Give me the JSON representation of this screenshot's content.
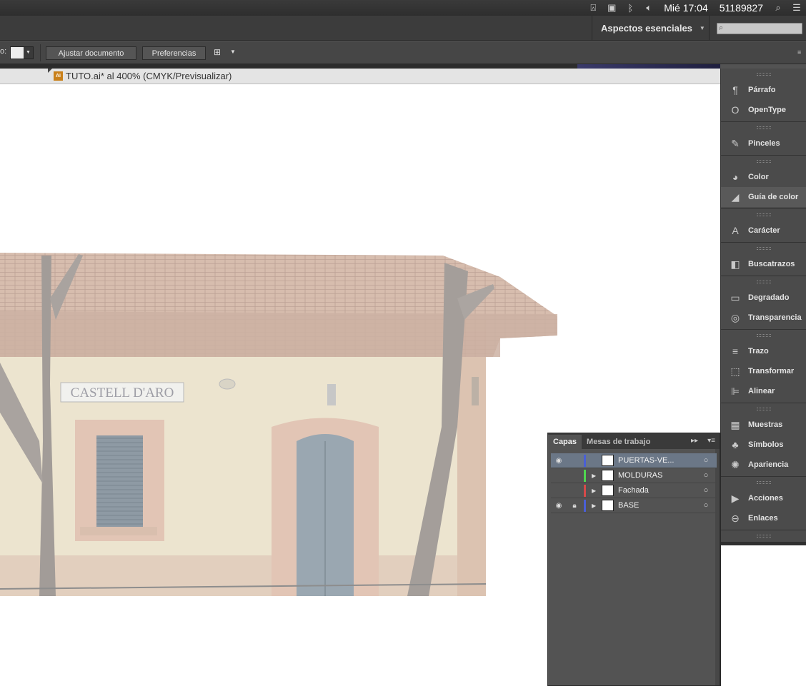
{
  "menubar": {
    "icons": [
      "adobe-icon",
      "display-icon",
      "bluetooth-icon",
      "volume-icon"
    ],
    "clock": "Mié 17:04",
    "user": "51189827"
  },
  "appbar": {
    "workspace_label": "Aspectos esenciales",
    "search_placeholder": ""
  },
  "controlbar": {
    "label_fragment": "o:",
    "fit_document_label": "Ajustar documento",
    "preferences_label": "Preferencias"
  },
  "document": {
    "tab_title": "TUTO.ai* al 400% (CMYK/Previsualizar)",
    "file_badge": "Ai",
    "sign_text": "CASTELL D'ARO"
  },
  "dock": {
    "groups": [
      [
        {
          "label": "Párrafo",
          "icon": "paragraph-icon"
        },
        {
          "label": "OpenType",
          "icon": "opentype-icon"
        }
      ],
      [
        {
          "label": "Pinceles",
          "icon": "brush-icon"
        }
      ],
      [
        {
          "label": "Color",
          "icon": "palette-icon"
        },
        {
          "label": "Guía de color",
          "icon": "color-guide-icon"
        }
      ],
      [
        {
          "label": "Carácter",
          "icon": "character-icon"
        }
      ],
      [
        {
          "label": "Buscatrazos",
          "icon": "pathfinder-icon"
        }
      ],
      [
        {
          "label": "Degradado",
          "icon": "gradient-icon"
        },
        {
          "label": "Transparencia",
          "icon": "transparency-icon"
        }
      ],
      [
        {
          "label": "Trazo",
          "icon": "stroke-icon"
        },
        {
          "label": "Transformar",
          "icon": "transform-icon"
        },
        {
          "label": "Alinear",
          "icon": "align-icon"
        }
      ],
      [
        {
          "label": "Muestras",
          "icon": "swatches-icon"
        },
        {
          "label": "Símbolos",
          "icon": "symbols-icon"
        },
        {
          "label": "Apariencia",
          "icon": "appearance-icon"
        }
      ],
      [
        {
          "label": "Acciones",
          "icon": "actions-icon"
        },
        {
          "label": "Enlaces",
          "icon": "links-icon"
        }
      ],
      [
        {
          "label": "Capas",
          "icon": "layers-icon"
        },
        {
          "label": "Mesas de traba...",
          "icon": "artboards-icon"
        }
      ]
    ]
  },
  "layers_panel": {
    "tabs": [
      "Capas",
      "Mesas de trabajo"
    ],
    "layers": [
      {
        "name": "PUERTAS-VE...",
        "visible": true,
        "locked": false,
        "color": "#4a5fd6",
        "selected": true
      },
      {
        "name": "MOLDURAS",
        "visible": false,
        "locked": false,
        "color": "#4fd64f",
        "selected": false
      },
      {
        "name": "Fachada",
        "visible": false,
        "locked": false,
        "color": "#d64a4a",
        "selected": false
      },
      {
        "name": "BASE",
        "visible": true,
        "locked": true,
        "color": "#4a5fd6",
        "selected": false
      }
    ]
  }
}
